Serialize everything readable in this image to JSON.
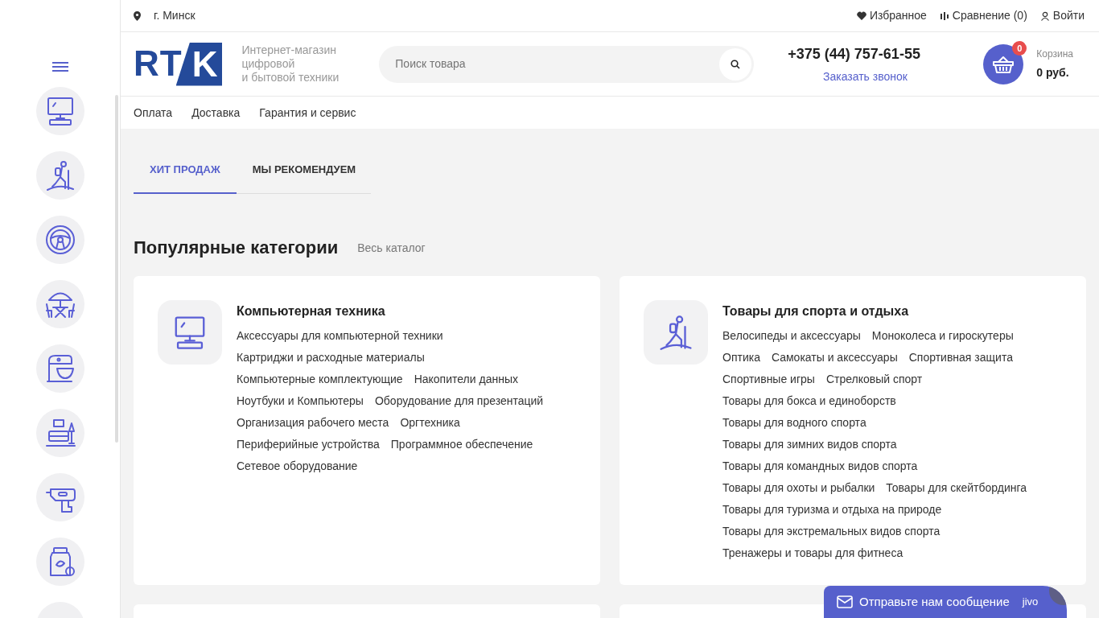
{
  "sidebar": {
    "items": [
      {
        "kind": "computer"
      },
      {
        "kind": "hiker"
      },
      {
        "kind": "wheel"
      },
      {
        "kind": "patio"
      },
      {
        "kind": "mixer"
      },
      {
        "kind": "sofa"
      },
      {
        "kind": "drill"
      },
      {
        "kind": "jar"
      },
      {
        "kind": "blank"
      }
    ]
  },
  "topbar": {
    "city": "г. Минск",
    "links": [
      {
        "kind": "heart",
        "label": "Избранное"
      },
      {
        "kind": "compare",
        "label": "Сравнение (0)"
      },
      {
        "kind": "user",
        "label": "Войти"
      }
    ]
  },
  "header": {
    "logo_left": "RT",
    "logo_right": "K",
    "tagline": [
      "Интернет-магазин",
      "цифровой",
      "и бытовой техники"
    ],
    "search": {
      "placeholder": "Поиск товара"
    },
    "phone": "+375 (44) 757-61-55",
    "callback": "Заказать звонок",
    "cart": {
      "count": "0",
      "label": "Корзина",
      "total": "0 руб."
    }
  },
  "menu": [
    "Оплата",
    "Доставка",
    "Гарантия и сервис"
  ],
  "tabs": [
    {
      "label": "ХИТ ПРОДАЖ",
      "selected": true
    },
    {
      "label": "МЫ РЕКОМЕНДУЕМ",
      "selected": false
    }
  ],
  "section": {
    "title": "Популярные категории",
    "link": "Весь каталог"
  },
  "categories": [
    {
      "kind": "computer",
      "title": "Компьютерная техника",
      "lines": [
        [
          "Аксессуары для компьютерной техники"
        ],
        [
          "Картриджи и расходные материалы"
        ],
        [
          "Компьютерные комплектующие",
          "Накопители данных"
        ],
        [
          "Ноутбуки и Компьютеры",
          "Оборудование для презентаций"
        ],
        [
          "Организация рабочего места",
          "Оргтехника"
        ],
        [
          "Периферийные устройства",
          "Программное обеспечение"
        ],
        [
          "Сетевое оборудование"
        ]
      ]
    },
    {
      "kind": "hiker",
      "title": "Товары для спорта и отдыха",
      "lines": [
        [
          "Велосипеды и аксессуары",
          "Моноколеса и гироскутеры"
        ],
        [
          "Оптика",
          "Самокаты и аксессуары",
          "Спортивная защита"
        ],
        [
          "Спортивные игры",
          "Стрелковый спорт"
        ],
        [
          "Товары для бокса и единоборств"
        ],
        [
          "Товары для водного спорта"
        ],
        [
          "Товары для зимних видов спорта"
        ],
        [
          "Товары для командных видов спорта"
        ],
        [
          "Товары для охоты и рыбалки",
          "Товары для скейтбординга"
        ],
        [
          "Товары для туризма и отдыха на природе"
        ],
        [
          "Товары для экстремальных видов спорта"
        ],
        [
          "Тренажеры и товары для фитнеса"
        ]
      ]
    }
  ],
  "chat": {
    "label": "Отправьте нам сообщение",
    "brand": "jivo"
  }
}
